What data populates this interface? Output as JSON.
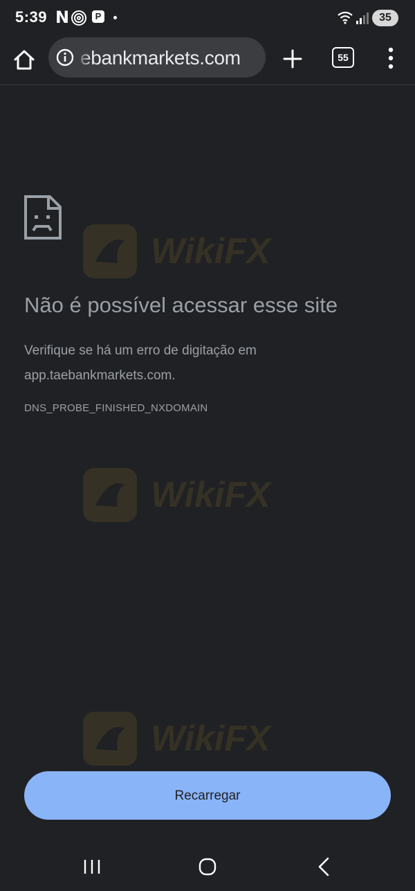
{
  "status_bar": {
    "time": "5:39",
    "notification_n": "N",
    "notification_p": "P",
    "battery": "35",
    "icons": [
      "n-app-icon",
      "fingerprint-icon",
      "p-app-icon",
      "dot-icon",
      "wifi-icon",
      "signal-icon",
      "battery-icon"
    ]
  },
  "toolbar": {
    "url": "ebankmarkets.com",
    "tab_count": "55",
    "icons": [
      "home-icon",
      "info-icon",
      "plus-icon",
      "tabs-icon",
      "more-vert-icon"
    ]
  },
  "error": {
    "icon": "sad-document-icon",
    "title": "Não é possível acessar esse site",
    "description": "Verifique se há um erro de digitação em app.taebankmarkets.com.",
    "code": "DNS_PROBE_FINISHED_NXDOMAIN"
  },
  "reload_button": {
    "label": "Recarregar",
    "color": "#8ab4f8"
  },
  "watermark": {
    "text": "WikiFX"
  },
  "nav_bar": {
    "icons": [
      "recents-icon",
      "home-circle-icon",
      "back-icon"
    ]
  },
  "colors": {
    "background": "#202124",
    "text_secondary": "#9aa0a6",
    "url_bar": "#3c3d40"
  }
}
